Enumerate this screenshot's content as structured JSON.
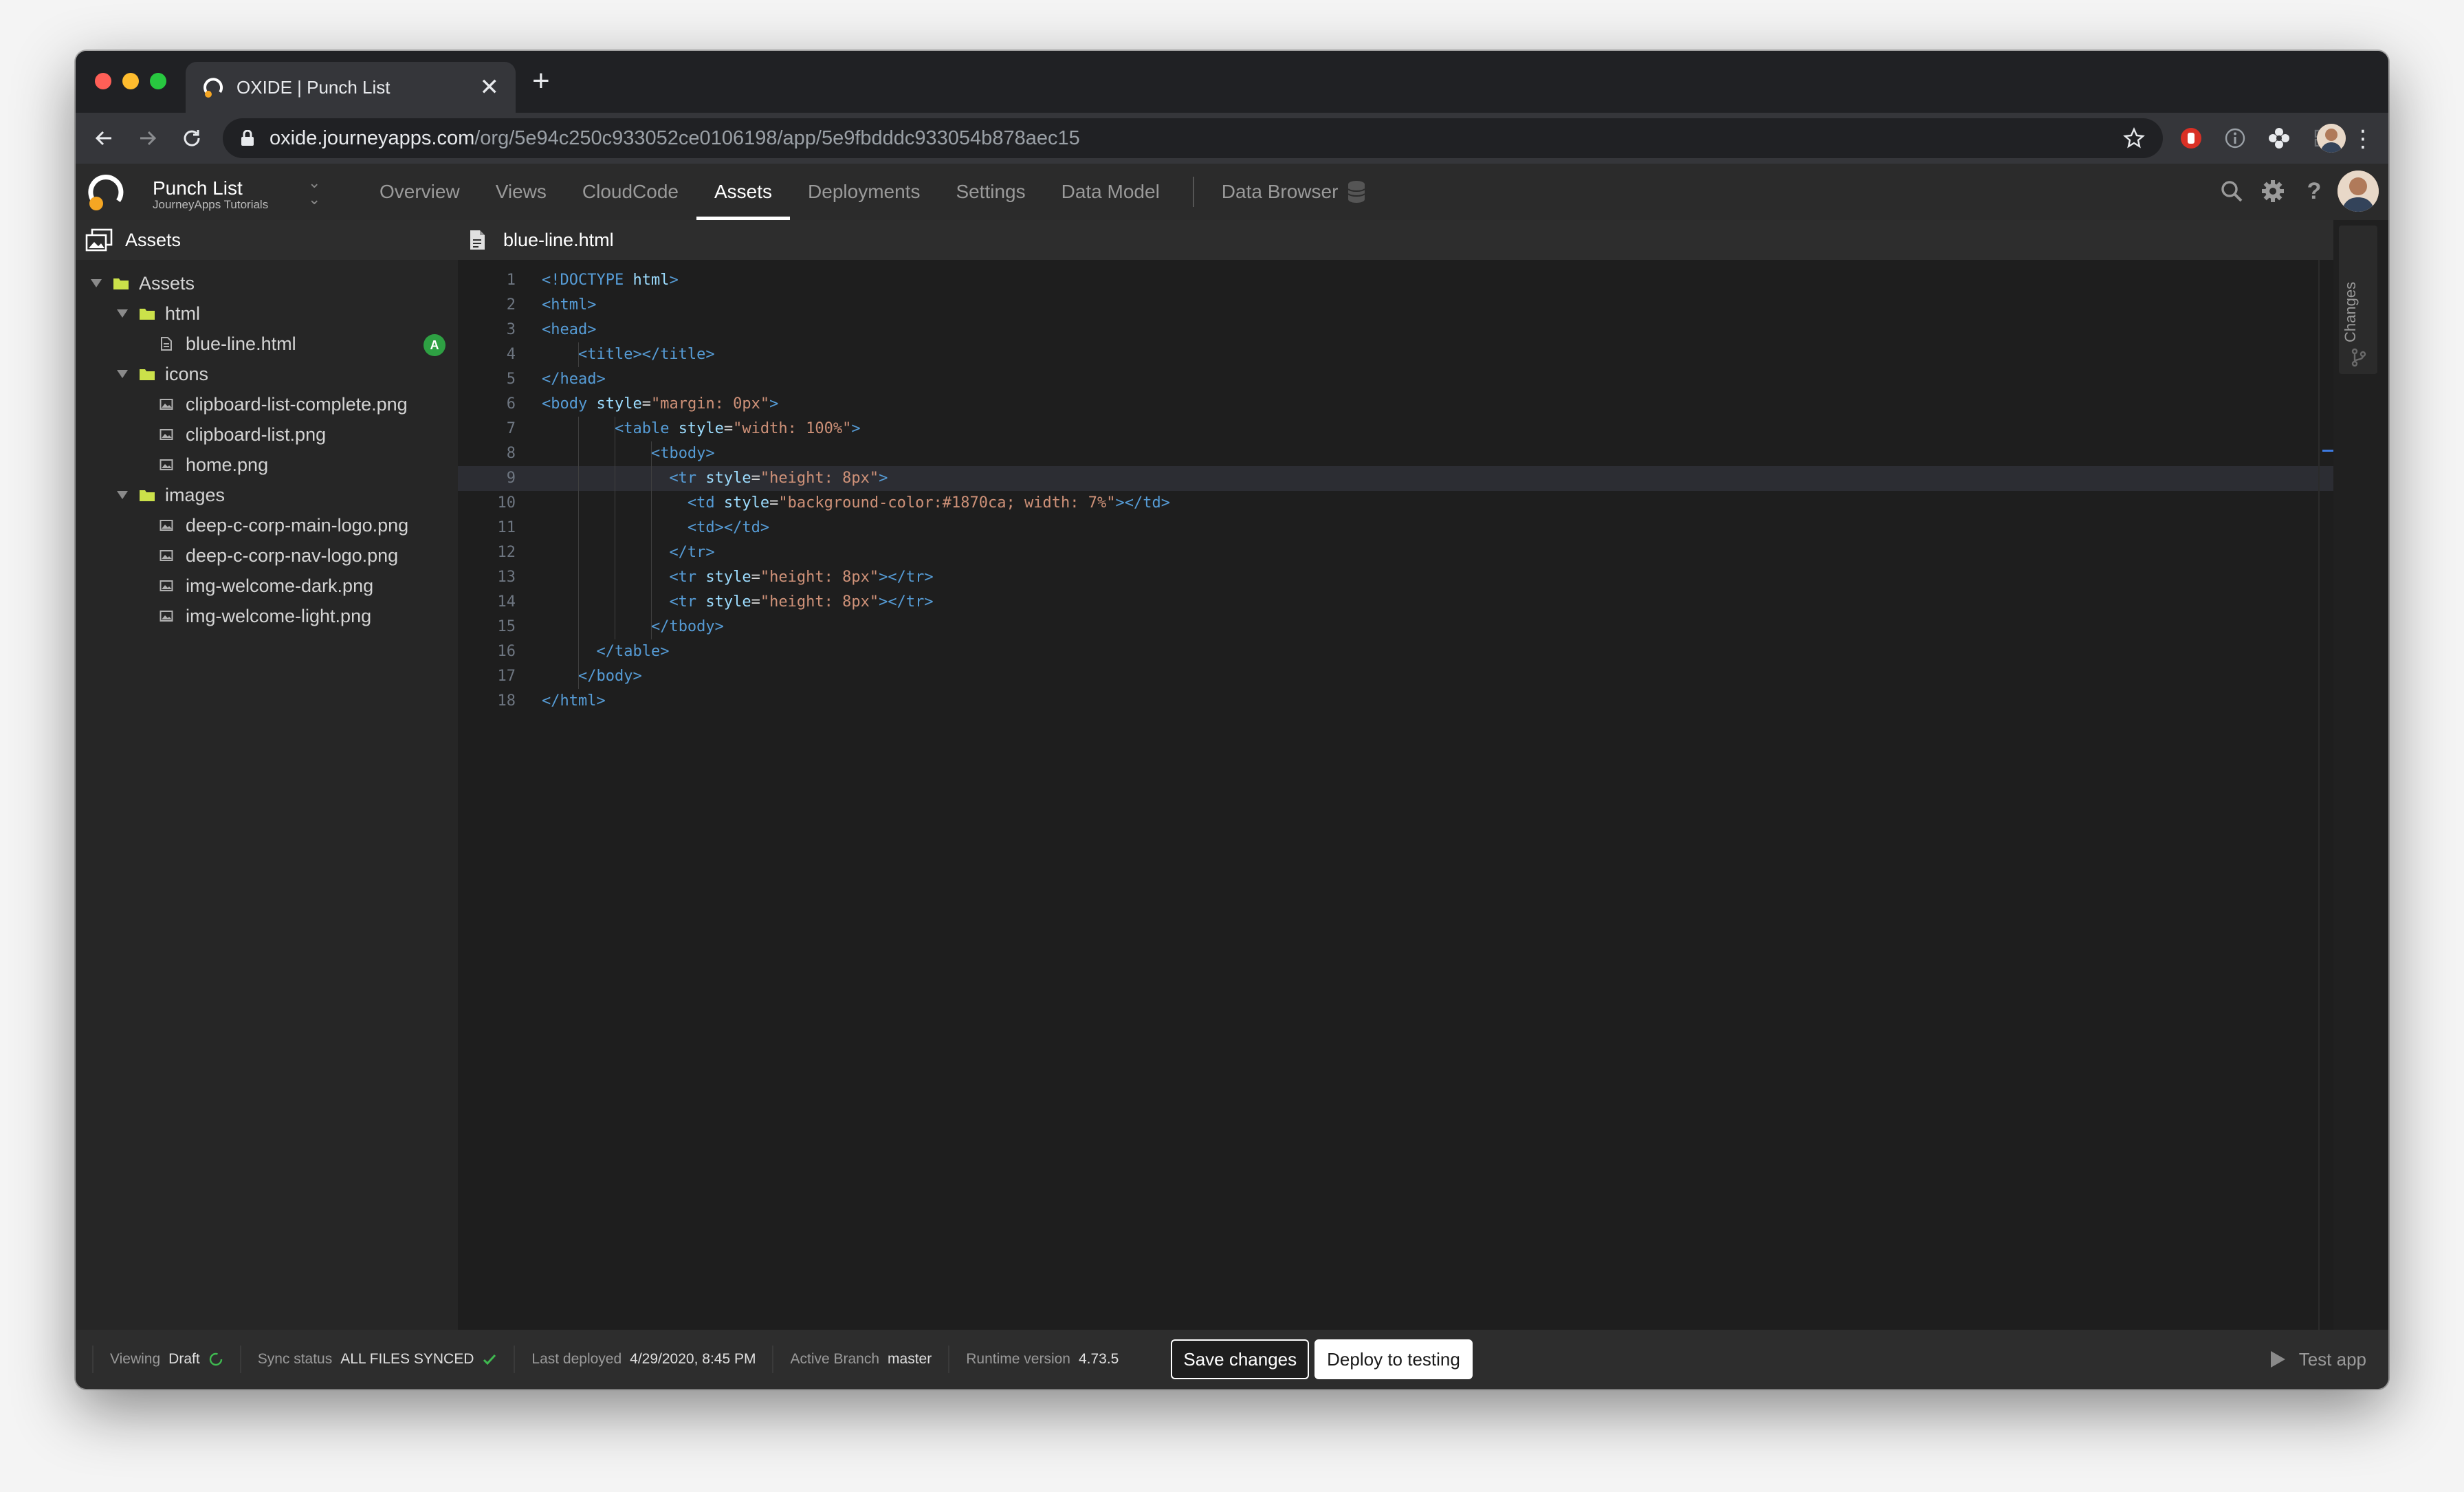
{
  "browser": {
    "tab_title": "OXIDE | Punch List",
    "new_tab": "+",
    "close": "✕",
    "url_host": "oxide.journeyapps.com",
    "url_path": "/org/5e94c250c933052ce0106198/app/5e9fbdddc933054b878aec15"
  },
  "app": {
    "name": "Punch List",
    "org": "JourneyApps Tutorials",
    "nav": [
      {
        "label": "Overview"
      },
      {
        "label": "Views"
      },
      {
        "label": "CloudCode"
      },
      {
        "label": "Assets"
      },
      {
        "label": "Deployments"
      },
      {
        "label": "Settings"
      },
      {
        "label": "Data Model"
      }
    ],
    "data_browser": "Data Browser",
    "active_tab": "Assets"
  },
  "sidebar": {
    "title": "Assets",
    "tree": [
      {
        "label": "Assets",
        "type": "folder",
        "depth": 0
      },
      {
        "label": "html",
        "type": "folder",
        "depth": 1
      },
      {
        "label": "blue-line.html",
        "type": "html",
        "depth": 2,
        "badge": "A"
      },
      {
        "label": "icons",
        "type": "folder",
        "depth": 1
      },
      {
        "label": "clipboard-list-complete.png",
        "type": "image",
        "depth": 2
      },
      {
        "label": "clipboard-list.png",
        "type": "image",
        "depth": 2
      },
      {
        "label": "home.png",
        "type": "image",
        "depth": 2
      },
      {
        "label": "images",
        "type": "folder",
        "depth": 1
      },
      {
        "label": "deep-c-corp-main-logo.png",
        "type": "image",
        "depth": 2
      },
      {
        "label": "deep-c-corp-nav-logo.png",
        "type": "image",
        "depth": 2
      },
      {
        "label": "img-welcome-dark.png",
        "type": "image",
        "depth": 2
      },
      {
        "label": "img-welcome-light.png",
        "type": "image",
        "depth": 2
      }
    ]
  },
  "editor": {
    "filename": "blue-line.html",
    "current_line": 9,
    "lines": [
      [
        [
          "t-tag",
          "<!DOCTYPE "
        ],
        [
          "t-name",
          "html"
        ],
        [
          "t-tag",
          ">"
        ]
      ],
      [
        [
          "t-tag",
          "<html>"
        ]
      ],
      [
        [
          "t-tag",
          "<head>"
        ]
      ],
      [
        [
          "t-text",
          "    "
        ],
        [
          "t-tag",
          "<title></title>"
        ]
      ],
      [
        [
          "t-tag",
          "</head>"
        ]
      ],
      [
        [
          "t-tag",
          "<body "
        ],
        [
          "t-name",
          "style"
        ],
        [
          "t-attr",
          "="
        ],
        [
          "t-str",
          "\"margin: 0px\""
        ],
        [
          "t-tag",
          ">"
        ]
      ],
      [
        [
          "t-text",
          "        "
        ],
        [
          "t-tag",
          "<table "
        ],
        [
          "t-name",
          "style"
        ],
        [
          "t-attr",
          "="
        ],
        [
          "t-str",
          "\"width: 100%\""
        ],
        [
          "t-tag",
          ">"
        ]
      ],
      [
        [
          "t-text",
          "            "
        ],
        [
          "t-tag",
          "<tbody>"
        ]
      ],
      [
        [
          "t-text",
          "              "
        ],
        [
          "t-tag",
          "<tr "
        ],
        [
          "t-name",
          "style"
        ],
        [
          "t-attr",
          "="
        ],
        [
          "t-str",
          "\"height: 8px\""
        ],
        [
          "t-tag",
          ">"
        ]
      ],
      [
        [
          "t-text",
          "                "
        ],
        [
          "t-tag",
          "<td "
        ],
        [
          "t-name",
          "style"
        ],
        [
          "t-attr",
          "="
        ],
        [
          "t-str",
          "\"background-color:#1870ca; width: 7%\""
        ],
        [
          "t-tag",
          "></td>"
        ]
      ],
      [
        [
          "t-text",
          "                "
        ],
        [
          "t-tag",
          "<td></td>"
        ]
      ],
      [
        [
          "t-text",
          "              "
        ],
        [
          "t-tag",
          "</tr>"
        ]
      ],
      [
        [
          "t-text",
          "              "
        ],
        [
          "t-tag",
          "<tr "
        ],
        [
          "t-name",
          "style"
        ],
        [
          "t-attr",
          "="
        ],
        [
          "t-str",
          "\"height: 8px\""
        ],
        [
          "t-tag",
          "></tr>"
        ]
      ],
      [
        [
          "t-text",
          "              "
        ],
        [
          "t-tag",
          "<tr "
        ],
        [
          "t-name",
          "style"
        ],
        [
          "t-attr",
          "="
        ],
        [
          "t-str",
          "\"height: 8px\""
        ],
        [
          "t-tag",
          "></tr>"
        ]
      ],
      [
        [
          "t-text",
          "            "
        ],
        [
          "t-tag",
          "</tbody>"
        ]
      ],
      [
        [
          "t-text",
          "      "
        ],
        [
          "t-tag",
          "</table>"
        ]
      ],
      [
        [
          "t-text",
          "    "
        ],
        [
          "t-tag",
          "</body>"
        ]
      ],
      [
        [
          "t-tag",
          "</html>"
        ]
      ]
    ]
  },
  "rail": {
    "changes": "Changes"
  },
  "status": {
    "viewing_label": "Viewing",
    "viewing_value": "Draft",
    "sync_label": "Sync status",
    "sync_value": "ALL FILES SYNCED",
    "deployed_label": "Last deployed",
    "deployed_value": "4/29/2020, 8:45 PM",
    "branch_label": "Active Branch",
    "branch_value": "master",
    "runtime_label": "Runtime version",
    "runtime_value": "4.73.5",
    "save_label": "Save changes",
    "deploy_label": "Deploy to testing",
    "test_label": "Test app"
  },
  "colors": {
    "background": "#202020",
    "badge_green": "#2ea043",
    "folder_yellow": "#cbe14a",
    "logo_orange": "#f5a623"
  }
}
